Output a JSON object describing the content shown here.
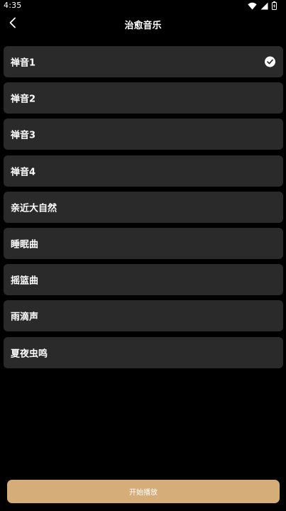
{
  "status_bar": {
    "time": "4:35",
    "icons": [
      "wifi-icon",
      "signal-icon",
      "battery-icon"
    ]
  },
  "header": {
    "back_icon": "chevron-left-icon",
    "title": "治愈音乐"
  },
  "music_list": {
    "items": [
      {
        "label": "禅音1",
        "selected": true
      },
      {
        "label": "禅音2",
        "selected": false
      },
      {
        "label": "禅音3",
        "selected": false
      },
      {
        "label": "禅音4",
        "selected": false
      },
      {
        "label": "亲近大自然",
        "selected": false
      },
      {
        "label": "睡眠曲",
        "selected": false
      },
      {
        "label": "摇篮曲",
        "selected": false
      },
      {
        "label": "雨滴声",
        "selected": false
      },
      {
        "label": "夏夜虫鸣",
        "selected": false
      }
    ],
    "selected_icon": "check-circle-icon"
  },
  "footer": {
    "play_label": "开始播放"
  },
  "colors": {
    "background": "#000000",
    "item_background": "#2a2a2a",
    "accent": "#d4ad79",
    "text": "#ffffff"
  }
}
